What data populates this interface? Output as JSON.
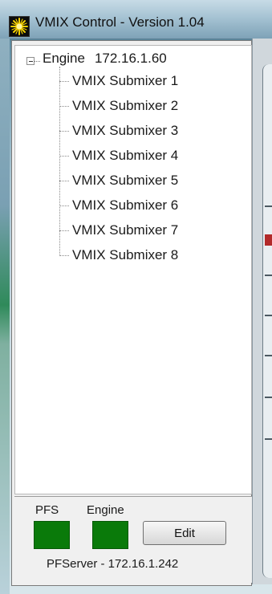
{
  "window": {
    "title": "VMIX Control - Version 1.04",
    "icon": "starburst-icon"
  },
  "tree": {
    "root": {
      "name": "Engine",
      "address": "172.16.1.60",
      "expanded": true
    },
    "items": [
      "VMIX Submixer 1",
      "VMIX Submixer 2",
      "VMIX Submixer 3",
      "VMIX Submixer 4",
      "VMIX Submixer 5",
      "VMIX Submixer 6",
      "VMIX Submixer 7",
      "VMIX Submixer 8"
    ]
  },
  "status": {
    "pfs_label": "PFS",
    "engine_label": "Engine",
    "edit_label": "Edit",
    "server_text": "PFServer - 172.16.1.242",
    "indicator_color": "#0a7a0a"
  }
}
